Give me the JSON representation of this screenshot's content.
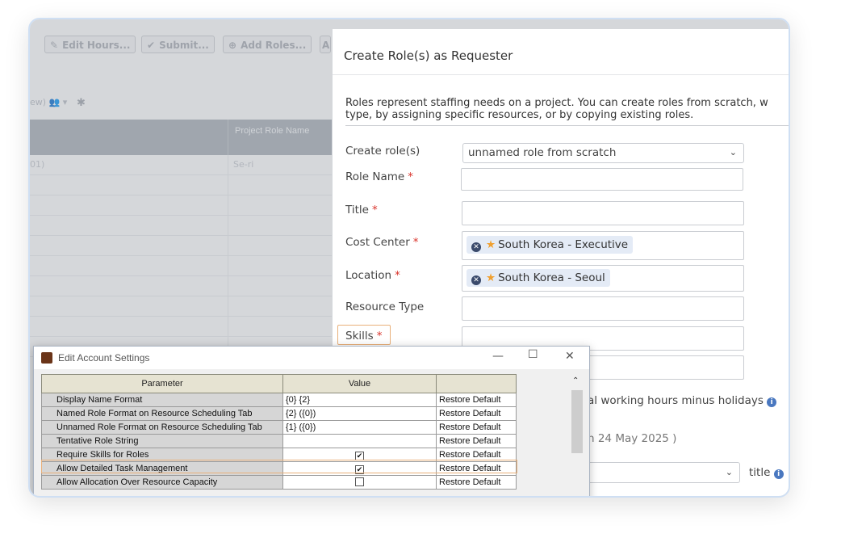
{
  "background_app": {
    "toolbar": [
      {
        "label": "Edit Hours...",
        "icon": "pencil-icon"
      },
      {
        "label": "Submit...",
        "icon": "check-icon"
      },
      {
        "label": "Add Roles...",
        "icon": "plus-circle-icon"
      },
      {
        "label": "A"
      }
    ],
    "filter_text": "ew)",
    "grid": {
      "column_header": "Project Role Name",
      "first_row": {
        "c1": "01)",
        "c2": "Se-ri"
      }
    }
  },
  "modal": {
    "title": "Create Role(s) as Requester",
    "description_line1": "Roles represent staffing needs on a project. You can create roles from scratch, w",
    "description_line2": "type, by assigning specific resources, or by copying existing roles.",
    "fields": {
      "create_roles": {
        "label": "Create role(s)",
        "value": "unnamed role from scratch"
      },
      "role_name": {
        "label": "Role Name",
        "required": "*"
      },
      "title": {
        "label": "Title",
        "required": "*"
      },
      "cost_center": {
        "label": "Cost Center",
        "required": "*",
        "chip": "South Korea - Executive"
      },
      "location": {
        "label": "Location",
        "required": "*",
        "chip": "South Korea - Seoul"
      },
      "resource_type": {
        "label": "Resource Type"
      },
      "skills": {
        "label": "Skills",
        "required": "*"
      }
    },
    "hours_text": "al working hours minus holidays",
    "date_text": "h 24 May 2025 )",
    "title_suffix": "title"
  },
  "settings_window": {
    "title": "Edit Account Settings",
    "controls": {
      "minimize": "—",
      "maximize": "☐",
      "close": "✕"
    },
    "headers": [
      "Parameter",
      "Value",
      ""
    ],
    "rows": [
      {
        "param": "Display Name Format",
        "value": "{0} {2}",
        "restore": "Restore Default"
      },
      {
        "param": "Named Role Format on Resource Scheduling Tab",
        "value": "{2} ({0})",
        "restore": "Restore Default"
      },
      {
        "param": "Unnamed Role Format on Resource Scheduling Tab",
        "value": "{1} ({0})",
        "restore": "Restore Default"
      },
      {
        "param": "Tentative Role String",
        "value": "",
        "restore": "Restore Default"
      },
      {
        "param": "Require Skills for Roles",
        "checked": true,
        "restore": "Restore Default"
      },
      {
        "param": "Allow Detailed Task Management",
        "checked": true,
        "restore": "Restore Default"
      },
      {
        "param": "Allow Allocation Over Resource Capacity",
        "checked": false,
        "restore": "Restore Default"
      }
    ]
  }
}
